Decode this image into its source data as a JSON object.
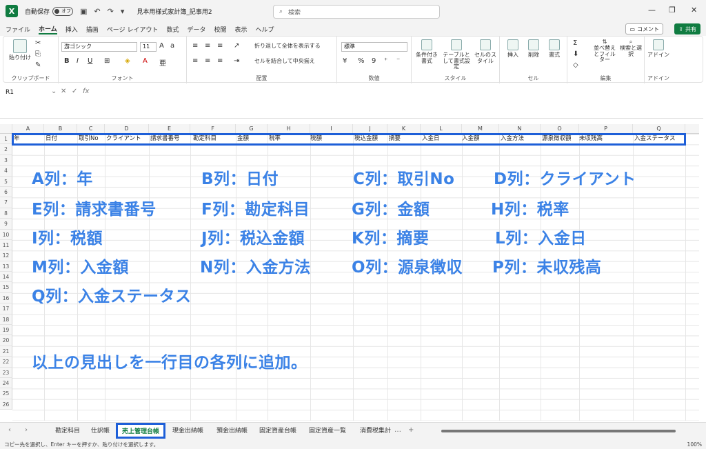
{
  "titlebar": {
    "app_letter": "X",
    "autosave_label": "自動保存",
    "toggle_state": "オフ",
    "doc_title": "見本用様式家計簿_記事用2",
    "search_placeholder": "検索"
  },
  "menu": {
    "tabs": [
      "ファイル",
      "ホーム",
      "挿入",
      "描画",
      "ページ レイアウト",
      "数式",
      "データ",
      "校閲",
      "表示",
      "ヘルプ"
    ],
    "active": "ホーム",
    "comment_label": "コメント",
    "share_label": "共有"
  },
  "ribbon": {
    "clipboard": {
      "paste": "貼り付け",
      "label": "クリップボード"
    },
    "font": {
      "family": "游ゴシック",
      "size": "11",
      "label": "フォント"
    },
    "alignment": {
      "wrap": "折り返して全体を表示する",
      "merge": "セルを結合して中央揃え",
      "label": "配置"
    },
    "number": {
      "format": "標準",
      "label": "数値"
    },
    "styles": {
      "conditional": "条件付き書式",
      "as_table": "テーブルとして書式設定",
      "cell_styles": "セルのスタイル",
      "label": "スタイル"
    },
    "cells": {
      "insert": "挿入",
      "delete": "削除",
      "format": "書式",
      "label": "セル"
    },
    "editing": {
      "sort": "並べ替えとフィルター",
      "find": "検索と選択",
      "label": "編集"
    },
    "addins": {
      "addin": "アドイン",
      "label": "アドイン"
    }
  },
  "formula_bar": {
    "name_box": "R1",
    "fx": "fx"
  },
  "columns": [
    "A",
    "B",
    "C",
    "D",
    "E",
    "F",
    "G",
    "H",
    "I",
    "J",
    "K",
    "L",
    "M",
    "N",
    "O",
    "P",
    "Q"
  ],
  "rows": [
    "1",
    "2",
    "3",
    "4",
    "5",
    "6",
    "7",
    "8",
    "9",
    "10",
    "11",
    "12",
    "13",
    "14",
    "15",
    "16",
    "17",
    "18",
    "19",
    "20",
    "21",
    "22",
    "23",
    "24",
    "25",
    "26"
  ],
  "header_cells": [
    "年",
    "日付",
    "取引No",
    "クライアント",
    "請求書番号",
    "勘定科目",
    "金額",
    "税率",
    "税額",
    "税込金額",
    "摘要",
    "入金日",
    "入金額",
    "入金方法",
    "源泉徴収額",
    "未収残高",
    "入金ステータス"
  ],
  "annotations": {
    "a": "A列：年",
    "b": "B列：日付",
    "c": "C列：取引No",
    "d": "D列：クライアント",
    "e": "E列：請求書番号",
    "f": "F列：勘定科目",
    "g": "G列：金額",
    "h": "H列：税率",
    "i": "I列：税額",
    "j": "J列：税込金額",
    "k": "K列：摘要",
    "l": "L列：入金日",
    "m": "M列：入金額",
    "n": "N列：入金方法",
    "o": "O列：源泉徴収",
    "p": "P列：未収残高",
    "q": "Q列：入金ステータス",
    "note": "以上の見出しを一行目の各列に追加。"
  },
  "sheets": [
    "勘定科目",
    "仕訳帳",
    "売上管理台帳",
    "現金出納帳",
    "預金出納帳",
    "固定資産台帳",
    "固定資産一覧",
    "消費税集計"
  ],
  "active_sheet": "売上管理台帳",
  "status": {
    "message": "コピー先を選択し、Enter キーを押すか、貼り付けを選択します。",
    "zoom": "100%"
  }
}
